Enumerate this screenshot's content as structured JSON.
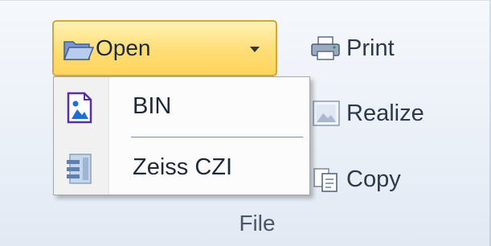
{
  "ribbon": {
    "group_label": "File",
    "open_button": {
      "label": "Open",
      "icon": "folder-open-icon"
    },
    "buttons": [
      {
        "label": "Print",
        "icon": "printer-icon"
      },
      {
        "label": "Realize",
        "icon": "image-icon"
      },
      {
        "label": "Copy",
        "icon": "copy-icon"
      }
    ]
  },
  "open_menu": {
    "items": [
      {
        "label": "BIN",
        "icon": "bin-image-file-icon"
      },
      {
        "label": "Zeiss CZI",
        "icon": "czi-file-icon"
      }
    ]
  },
  "colors": {
    "open_button_highlight": "#ffde78",
    "open_button_border": "#d6a532",
    "menu_background": "#fcfcfc",
    "ribbon_background": "#eef3f9"
  }
}
